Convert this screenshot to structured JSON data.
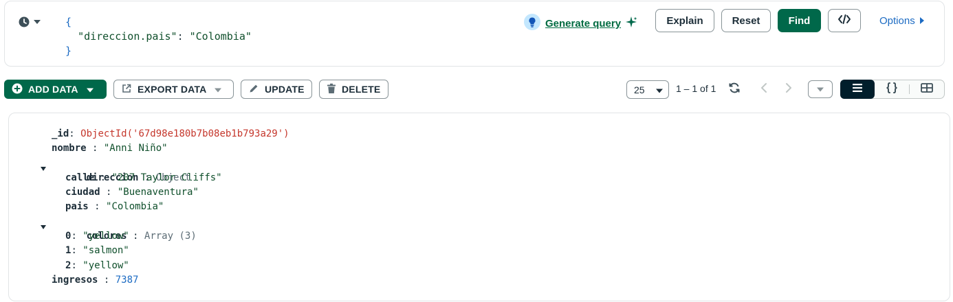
{
  "query": {
    "open_brace": "{",
    "key": "\"direccion.pais\"",
    "colon": ": ",
    "value": "\"Colombia\"",
    "close_brace": "}"
  },
  "header": {
    "generate_query": "Generate query",
    "explain": "Explain",
    "reset": "Reset",
    "find": "Find",
    "options": "Options"
  },
  "toolbar": {
    "add_data": "ADD DATA",
    "export_data": "EXPORT DATA",
    "update": "UPDATE",
    "delete": "DELETE",
    "page_size": "25",
    "page_info": "1 – 1 of 1"
  },
  "document": {
    "id_key": "_id",
    "id_value": "ObjectId('67d98e180b7b08eb1b793a29')",
    "nombre_key": "nombre",
    "nombre_value": "\"Anni Niño\"",
    "direccion_key": "direccion",
    "direccion_type": "Object",
    "calle_key": "calle",
    "calle_value": "\"207 Taylor Cliffs\"",
    "ciudad_key": "ciudad",
    "ciudad_value": "\"Buenaventura\"",
    "pais_key": "pais",
    "pais_value": "\"Colombia\"",
    "colores_key": "colores",
    "colores_type": "Array (3)",
    "c0_key": "0",
    "c0_value": "\"yellow\"",
    "c1_key": "1",
    "c1_value": "\"salmon\"",
    "c2_key": "2",
    "c2_value": "\"yellow\"",
    "ingresos_key": "ingresos",
    "ingresos_value": "7387"
  },
  "icons": [
    "clock-icon",
    "chevron-down-icon",
    "lightbulb-icon",
    "sparkle-icon",
    "code-icon",
    "caret-right-icon",
    "plus-circle-icon",
    "export-icon",
    "pencil-icon",
    "trash-icon",
    "refresh-icon",
    "chevron-left-icon",
    "chevron-right-icon",
    "list-view-icon",
    "json-view-icon",
    "table-view-icon"
  ],
  "colors": {
    "brand_green": "#00684a",
    "link_blue": "#1c6bc3",
    "string_green": "#0f4f2b",
    "objectid_red": "#c5372c",
    "dark_navy": "#001e2b"
  }
}
